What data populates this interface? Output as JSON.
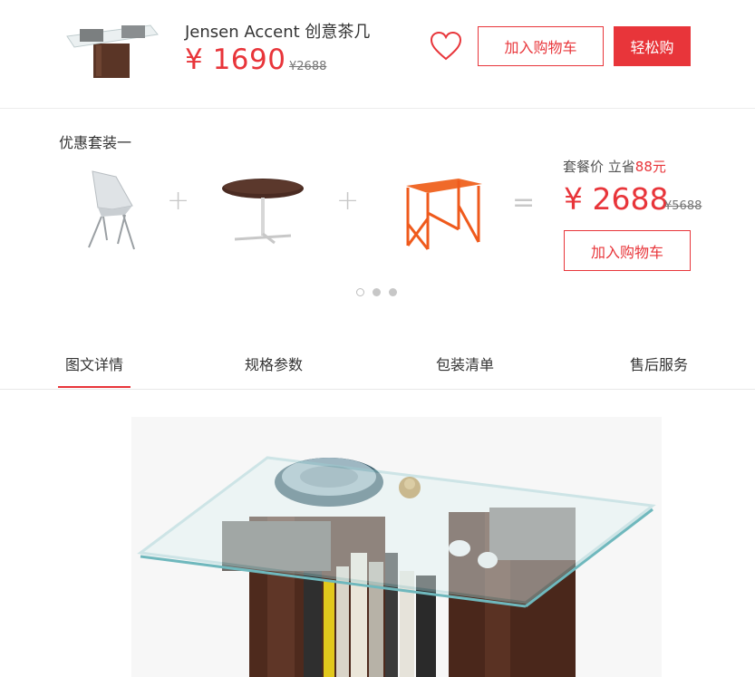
{
  "product": {
    "title": "Jensen Accent 创意茶几",
    "price": "¥ 1690",
    "original_price": "¥2688",
    "favorite_icon": "heart-outline-icon",
    "add_to_cart_label": "加入购物车",
    "buy_now_label": "轻松购"
  },
  "bundle": {
    "title": "优惠套装一",
    "items": [
      {
        "name": "white-chair"
      },
      {
        "name": "round-side-table"
      },
      {
        "name": "orange-side-table"
      }
    ],
    "plus_symbol": "+",
    "equals_symbol": "=",
    "combo_label": "套餐价 立省",
    "combo_save_amount": "88元",
    "combo_price": "¥ 2688",
    "combo_original_price": "¥5688",
    "add_to_cart_label": "加入购物车",
    "carousel_pages": 3,
    "carousel_active": 1
  },
  "tabs": [
    {
      "label": "图文详情",
      "active": true
    },
    {
      "label": "规格参数",
      "active": false
    },
    {
      "label": "包装清单",
      "active": false
    },
    {
      "label": "售后服务",
      "active": false
    }
  ],
  "colors": {
    "accent": "#e8353a",
    "text": "#333333",
    "muted": "#777777",
    "divider": "#ececec"
  }
}
